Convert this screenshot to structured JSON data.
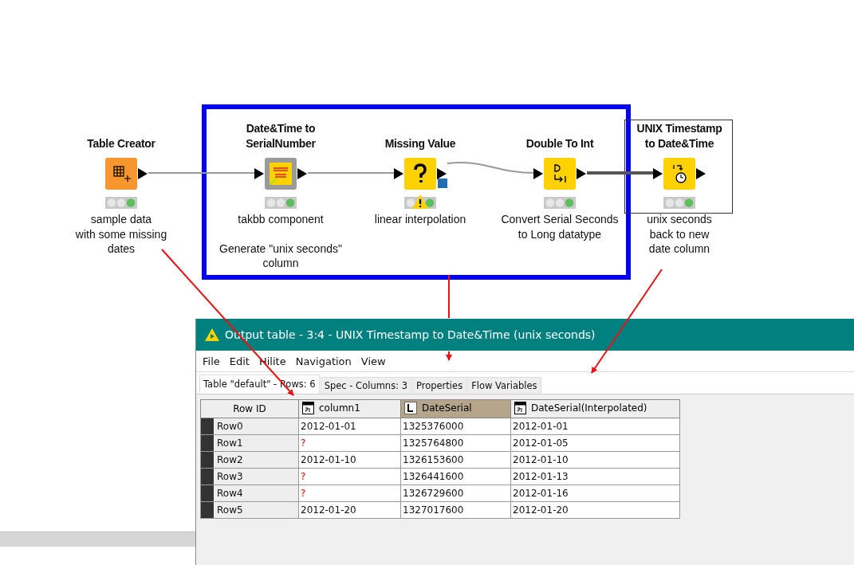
{
  "workflow": {
    "nodes": [
      {
        "title": "Table Creator",
        "kind": "table-creator",
        "executed": true,
        "warning": false,
        "annotations": [
          "sample data\nwith some missing\ndates"
        ]
      },
      {
        "title": "Date&Time to\nSerialNumber",
        "kind": "component",
        "executed": true,
        "warning": false,
        "annotations": [
          "takbb component",
          "Generate \"unix seconds\"\ncolumn"
        ]
      },
      {
        "title": "Missing Value",
        "kind": "missing-value",
        "executed": true,
        "warning": true,
        "annotations": [
          "linear interpolation"
        ]
      },
      {
        "title": "Double To Int",
        "kind": "double-to-int",
        "executed": true,
        "warning": false,
        "annotations": [
          "Convert Serial Seconds\nto Long datatype"
        ]
      },
      {
        "title": "UNIX Timestamp\nto Date&Time",
        "kind": "unix-to-date",
        "executed": true,
        "warning": false,
        "annotations": [
          "unix seconds\nback to new\ndate column"
        ]
      }
    ]
  },
  "output_window": {
    "title": "Output table - 3:4 - UNIX Timestamp to Date&Time (unix seconds)",
    "menu": [
      "File",
      "Edit",
      "Hilite",
      "Navigation",
      "View"
    ],
    "tabs": [
      {
        "label": "Table \"default\" - Rows: 6",
        "selected": true
      },
      {
        "label": "Spec - Columns: 3",
        "selected": false
      },
      {
        "label": "Properties",
        "selected": false
      },
      {
        "label": "Flow Variables",
        "selected": false
      }
    ],
    "table": {
      "row_id_header": "Row ID",
      "columns": [
        {
          "name": "column1",
          "kind": "date",
          "selected": false
        },
        {
          "name": "DateSerial",
          "kind": "long",
          "selected": true
        },
        {
          "name": "DateSerial(Interpolated)",
          "kind": "date",
          "selected": false
        }
      ],
      "rows": [
        {
          "id": "Row0",
          "cells": [
            {
              "text": "2012-01-01",
              "missing": false
            },
            {
              "text": "1325376000",
              "missing": false
            },
            {
              "text": "2012-01-01",
              "missing": false
            }
          ]
        },
        {
          "id": "Row1",
          "cells": [
            {
              "text": "?",
              "missing": true
            },
            {
              "text": "1325764800",
              "missing": false
            },
            {
              "text": "2012-01-05",
              "missing": false
            }
          ]
        },
        {
          "id": "Row2",
          "cells": [
            {
              "text": "2012-01-10",
              "missing": false
            },
            {
              "text": "1326153600",
              "missing": false
            },
            {
              "text": "2012-01-10",
              "missing": false
            }
          ]
        },
        {
          "id": "Row3",
          "cells": [
            {
              "text": "?",
              "missing": true
            },
            {
              "text": "1326441600",
              "missing": false
            },
            {
              "text": "2012-01-13",
              "missing": false
            }
          ]
        },
        {
          "id": "Row4",
          "cells": [
            {
              "text": "?",
              "missing": true
            },
            {
              "text": "1326729600",
              "missing": false
            },
            {
              "text": "2012-01-16",
              "missing": false
            }
          ]
        },
        {
          "id": "Row5",
          "cells": [
            {
              "text": "2012-01-20",
              "missing": false
            },
            {
              "text": "1327017600",
              "missing": false
            },
            {
              "text": "2012-01-20",
              "missing": false
            }
          ]
        }
      ]
    }
  }
}
